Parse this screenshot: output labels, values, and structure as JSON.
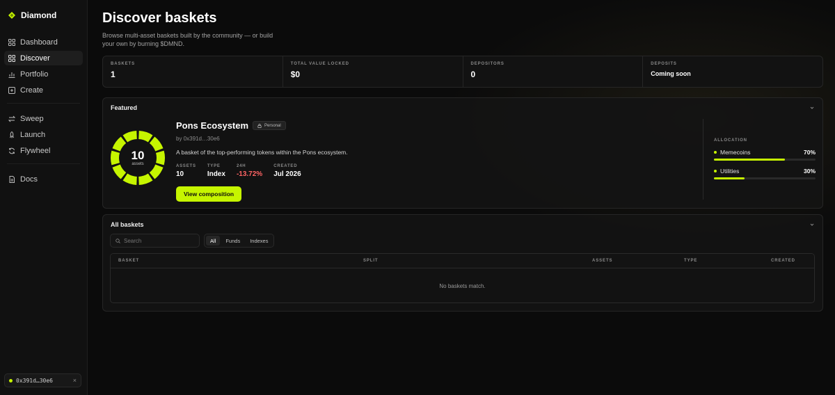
{
  "brand": {
    "name": "Diamond",
    "accent": "#c6f500"
  },
  "nav": {
    "items": [
      {
        "label": "Dashboard",
        "icon": "grid-icon"
      },
      {
        "label": "Discover",
        "icon": "apps-icon",
        "active": true
      },
      {
        "label": "Portfolio",
        "icon": "bar-chart-icon"
      },
      {
        "label": "Create",
        "icon": "plus-square-icon"
      }
    ],
    "tools": [
      {
        "label": "Sweep",
        "icon": "swap-icon"
      },
      {
        "label": "Launch",
        "icon": "rocket-icon"
      },
      {
        "label": "Flywheel",
        "icon": "refresh-icon"
      }
    ],
    "docs": {
      "label": "Docs",
      "icon": "document-icon"
    }
  },
  "wallet": {
    "address": "0x391d…30e6",
    "close": "×"
  },
  "page": {
    "title": "Discover baskets",
    "subtitle": "Browse multi-asset baskets built by the community — or build your own by burning $DMND."
  },
  "stats": [
    {
      "label": "BASKETS",
      "value": "1"
    },
    {
      "label": "TOTAL VALUE LOCKED",
      "value": "$0"
    },
    {
      "label": "DEPOSITORS",
      "value": "0"
    },
    {
      "label": "DEPOSITS",
      "value": "Coming soon"
    }
  ],
  "featured": {
    "heading": "Featured",
    "donut": {
      "count": "10",
      "label": "assets",
      "segments": 10
    },
    "name": "Pons Ecosystem",
    "badge": "Personal",
    "by": "by 0x391d…30e6",
    "description": "A basket of the top-performing tokens within the Pons ecosystem.",
    "meta": [
      {
        "label": "ASSETS",
        "value": "10"
      },
      {
        "label": "TYPE",
        "value": "Index"
      },
      {
        "label": "24H",
        "value": "-13.72%",
        "negative": true
      },
      {
        "label": "CREATED",
        "value": "Jul 2026"
      }
    ],
    "cta": "View composition",
    "allocation": {
      "label": "ALLOCATION",
      "items": [
        {
          "name": "Memecoins",
          "pct_label": "70%",
          "fraction": 0.7
        },
        {
          "name": "Utilities",
          "pct_label": "30%",
          "fraction": 0.3
        }
      ]
    }
  },
  "all_baskets": {
    "heading": "All baskets",
    "search_placeholder": "Search",
    "filters": [
      {
        "label": "All",
        "active": true
      },
      {
        "label": "Funds"
      },
      {
        "label": "Indexes"
      }
    ],
    "columns": [
      "BASKET",
      "SPLIT",
      "ASSETS",
      "TYPE",
      "CREATED"
    ],
    "empty": "No baskets match."
  }
}
